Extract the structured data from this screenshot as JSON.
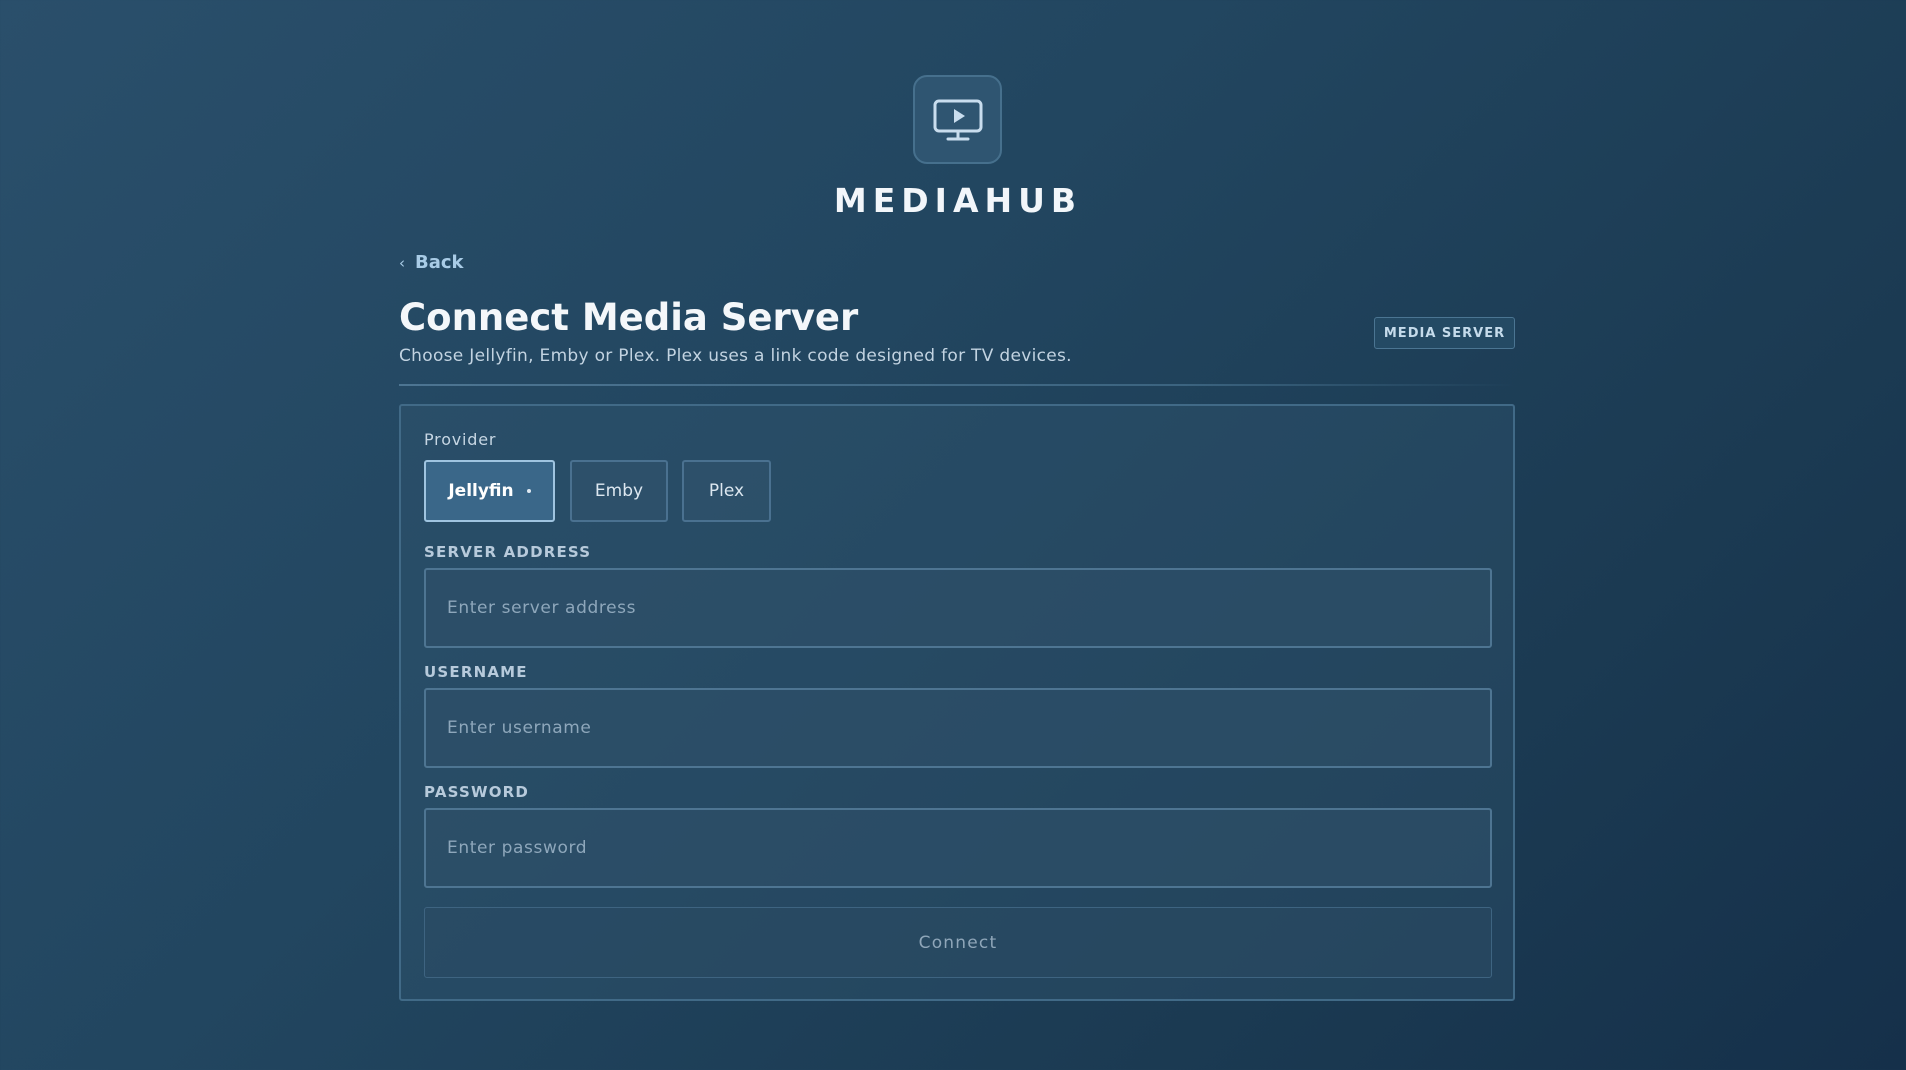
{
  "app": {
    "brand": "MEDIAHUB",
    "logo_icon": "monitor-play-icon"
  },
  "nav": {
    "back_label": "Back",
    "back_icon": "chevron-left-icon"
  },
  "header": {
    "title": "Connect Media Server",
    "subtitle": "Choose Jellyfin, Emby or Plex. Plex uses a link code designed for TV devices.",
    "badge": "MEDIA SERVER"
  },
  "form": {
    "provider_label": "Provider",
    "providers": [
      {
        "label": "Jellyfin",
        "selected": true
      },
      {
        "label": "Emby",
        "selected": false
      },
      {
        "label": "Plex",
        "selected": false
      }
    ],
    "server_address": {
      "label": "SERVER ADDRESS",
      "placeholder": "Enter server address",
      "value": ""
    },
    "username": {
      "label": "USERNAME",
      "placeholder": "Enter username",
      "value": ""
    },
    "password": {
      "label": "PASSWORD",
      "placeholder": "Enter password",
      "value": ""
    },
    "connect_label": "Connect",
    "connect_enabled": false
  },
  "colors": {
    "accent": "#9fc4e0",
    "link": "#a9cce6",
    "background_start": "#2a4f6b",
    "background_end": "#15304a"
  }
}
